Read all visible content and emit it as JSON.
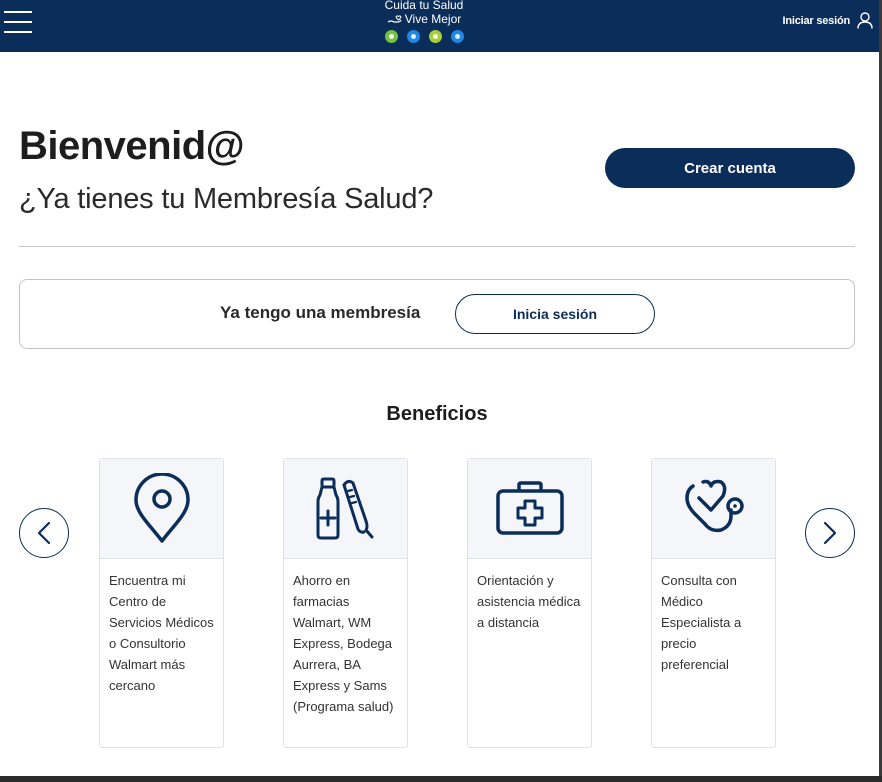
{
  "header": {
    "brand_line1": "Cuida tu Salud",
    "brand_line2": "Vive Mejor",
    "login_label": "Iniciar sesión",
    "dot_colors": [
      "#76c043",
      "#1e88e5",
      "#a6ce39",
      "#1e88e5"
    ]
  },
  "hero": {
    "title": "Bienvenid@",
    "subtitle": "¿Ya tienes tu Membresía Salud?",
    "create_button": "Crear cuenta"
  },
  "membership": {
    "text": "Ya tengo una membresía",
    "signin_button": "Inicia sesión"
  },
  "benefits": {
    "title": "Beneficios",
    "items": [
      {
        "icon": "location-pin-icon",
        "text": "Encuentra mi Centro de Servicios Médicos o Consultorio Walmart más cercano"
      },
      {
        "icon": "medicine-thermometer-icon",
        "text": "Ahorro en farmacias Walmart, WM Express, Bodega Aurrera, BA Express y Sams (Programa salud)"
      },
      {
        "icon": "medical-kit-icon",
        "text": "Orientación y asistencia médica a distancia"
      },
      {
        "icon": "stethoscope-icon",
        "text": "Consulta con Médico Especialista a precio preferencial"
      }
    ]
  },
  "colors": {
    "primary": "#0b2d5a",
    "card_top": "#f5f6fa"
  }
}
